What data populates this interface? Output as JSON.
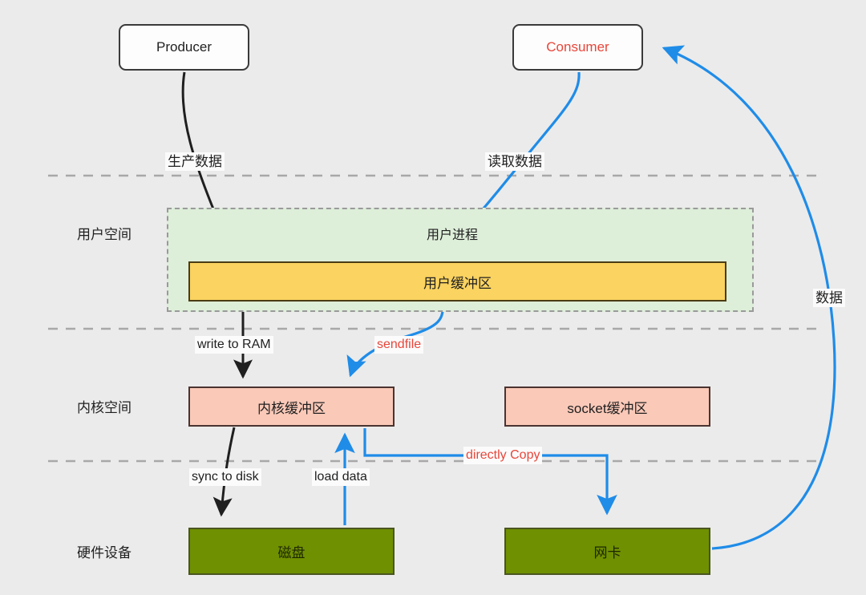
{
  "diagram": {
    "title": "zero-copy data flow",
    "background_color": "#ebebeb",
    "accent_color": "#e8463a",
    "flow_color": "#1f8ce8"
  },
  "endpoints": [
    {
      "id": "producer",
      "label": "Producer"
    },
    {
      "id": "consumer",
      "label": "Consumer"
    }
  ],
  "zones": [
    {
      "id": "user-space",
      "label": "用户空间"
    },
    {
      "id": "kernel-space",
      "label": "内核空间"
    },
    {
      "id": "hardware",
      "label": "硬件设备"
    }
  ],
  "regions": [
    {
      "id": "user-process",
      "label": "用户进程"
    }
  ],
  "buffers": [
    {
      "id": "user-buffer",
      "label": "用户缓冲区"
    },
    {
      "id": "kernel-buffer",
      "label": "内核缓冲区"
    },
    {
      "id": "socket-buffer",
      "label": "socket缓冲区"
    }
  ],
  "devices": [
    {
      "id": "disk",
      "label": "磁盘"
    },
    {
      "id": "nic",
      "label": "网卡"
    }
  ],
  "edges": [
    {
      "id": "produce-data",
      "label": "生产数据",
      "color": "black"
    },
    {
      "id": "read-data",
      "label": "读取数据",
      "color": "blue"
    },
    {
      "id": "write-to-ram",
      "label": "write to RAM",
      "color": "black"
    },
    {
      "id": "sendfile",
      "label": "sendfile",
      "color": "red"
    },
    {
      "id": "sync-to-disk",
      "label": "sync to disk",
      "color": "black"
    },
    {
      "id": "load-data",
      "label": "load data",
      "color": "blue"
    },
    {
      "id": "directly-copy",
      "label": "directly Copy",
      "color": "red"
    },
    {
      "id": "data-return",
      "label": "数据",
      "color": "blue"
    }
  ]
}
